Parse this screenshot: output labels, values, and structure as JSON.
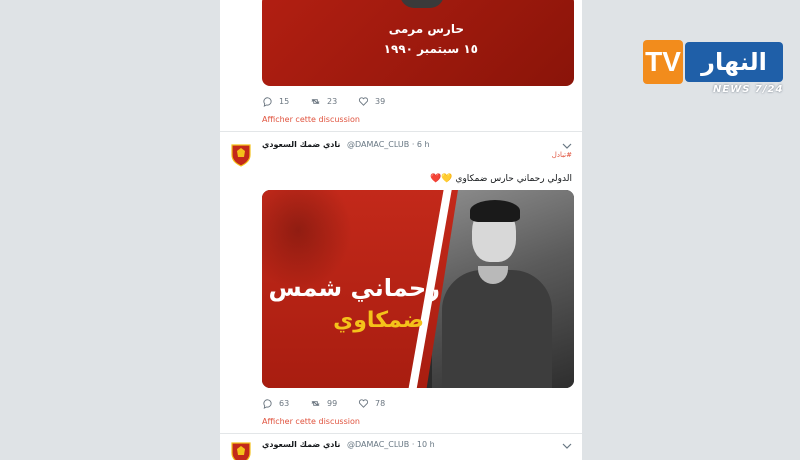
{
  "top_tweet": {
    "image": {
      "role_text": "حارس مرمى",
      "date_text": "١٥ سبتمبر ١٩٩٠"
    },
    "replies": "15",
    "retweets": "23",
    "likes": "39",
    "discussion_link": "Afficher cette discussion"
  },
  "main_tweet": {
    "account_name": "نادي ضمك السعودي",
    "handle": "@DAMAC_CLUB",
    "time": "· 6 h",
    "hashtag": "#تبادل",
    "text": "الدولي رحماني حارس ضمكاوي 💛❤️",
    "image": {
      "name_line1": "رحماني شمس الدين",
      "name_line2": "ضمكاوي"
    },
    "replies": "63",
    "retweets": "99",
    "likes": "78",
    "discussion_link": "Afficher cette discussion"
  },
  "next_tweet": {
    "account_name": "نادي ضمك السعودي",
    "handle": "@DAMAC_CLUB",
    "time": "· 10 h"
  },
  "logo": {
    "tv": "TV",
    "brand": "النهار",
    "news": "NEWS 7/24"
  },
  "colors": {
    "accent": "#e0533e",
    "club_red": "#b21f12",
    "club_yellow": "#f4c21a",
    "logo_orange": "#f28c1c",
    "logo_blue": "#1f5fa8"
  }
}
